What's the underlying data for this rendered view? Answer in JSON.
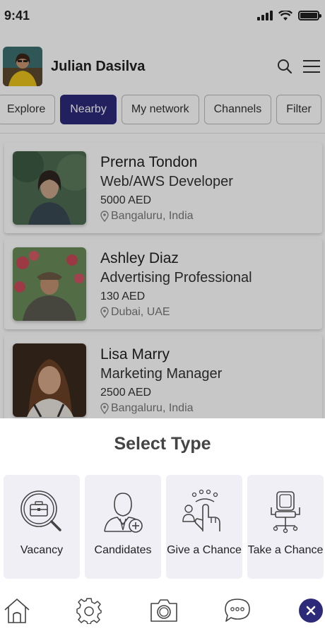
{
  "status_bar": {
    "time": "9:41"
  },
  "header": {
    "user_name": "Julian Dasilva"
  },
  "tabs": [
    {
      "label": "Explore",
      "active": false
    },
    {
      "label": "Nearby",
      "active": true
    },
    {
      "label": "My network",
      "active": false
    },
    {
      "label": "Channels",
      "active": false
    },
    {
      "label": "Filter",
      "active": false
    }
  ],
  "profiles": [
    {
      "name": "Prerna Tondon",
      "role": "Web/AWS Developer",
      "price": "5000 AED",
      "location": "Bangaluru, India"
    },
    {
      "name": "Ashley Diaz",
      "role": "Advertising Professional",
      "price": "130 AED",
      "location": "Dubai, UAE"
    },
    {
      "name": "Lisa Marry",
      "role": "Marketing Manager",
      "price": "2500 AED",
      "location": "Bangaluru, India"
    }
  ],
  "sheet": {
    "title": "Select Type",
    "options": [
      {
        "label": "Vacancy",
        "icon": "briefcase-search-icon"
      },
      {
        "label": "Candidates",
        "icon": "candidate-add-icon"
      },
      {
        "label": "Give a Chance",
        "icon": "hand-touch-icon"
      },
      {
        "label": "Take a Chance",
        "icon": "office-chair-icon"
      }
    ]
  },
  "bottom_nav": [
    "home-icon",
    "gear-icon",
    "camera-icon",
    "chat-icon",
    "close-icon"
  ],
  "colors": {
    "accent": "#2d2a7a",
    "option_bg": "#f0eff6"
  }
}
